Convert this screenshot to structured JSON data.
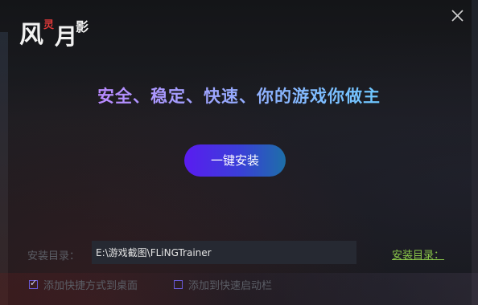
{
  "logo": {
    "chars": [
      "风",
      "灵",
      "月",
      "影"
    ]
  },
  "window": {
    "close_icon": "close-icon"
  },
  "main": {
    "slogan": "安全、稳定、快速、你的游戏你做主",
    "install_button": "一键安装"
  },
  "install_dir": {
    "label": "安装目录：",
    "path": "E:\\游戏截图\\FLiNGTrainer",
    "link": "安装目录："
  },
  "options": {
    "desktop_shortcut": {
      "label": "添加快捷方式到桌面",
      "checked": true
    },
    "quick_launch": {
      "label": "添加到快速启动栏",
      "checked": false
    }
  },
  "colors": {
    "accent_purple": "#5a1cf0",
    "link_green": "#8ac64a",
    "slogan_start": "#c77dff",
    "slogan_end": "#5fd1ff"
  }
}
